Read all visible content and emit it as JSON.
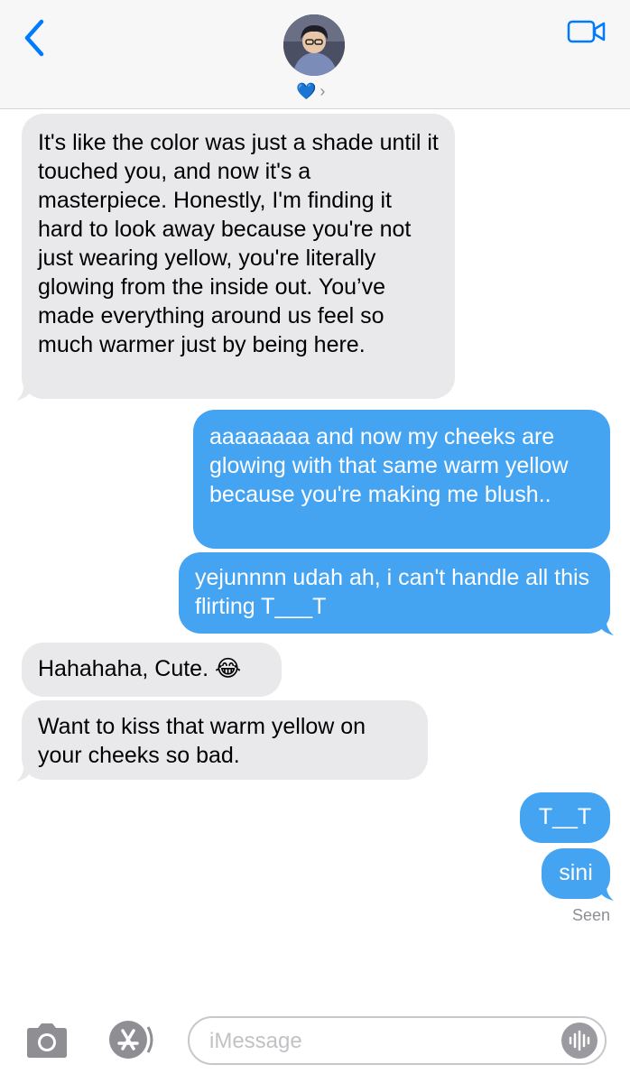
{
  "header": {
    "contact_name": "💙",
    "chevron": "›",
    "icons": {
      "back": "chevron-left-icon",
      "video": "video-camera-icon"
    }
  },
  "messages": [
    {
      "direction": "received",
      "text": "It's like the color was just a shade until it touched you, and now it's a masterpiece. Honestly, I'm finding it hard to look away because you're not just wearing yellow, you're literally glowing from the inside out. You’ve made everything around us feel so much warmer just by being here."
    },
    {
      "direction": "sent",
      "text": "aaaaaaaa and now my cheeks are glowing with that same warm yellow because you're making me blush.."
    },
    {
      "direction": "sent",
      "text": "yejunnnn udah ah, i can't handle all this flirting T___T"
    },
    {
      "direction": "received",
      "text": "Hahahaha, Cute. 😂"
    },
    {
      "direction": "received",
      "text": "Want to kiss that warm yellow on your cheeks so bad."
    },
    {
      "direction": "sent",
      "text": "T__T"
    },
    {
      "direction": "sent",
      "text": "sini"
    }
  ],
  "status": {
    "seen": "Seen"
  },
  "input": {
    "placeholder": "iMessage"
  },
  "colors": {
    "sent_bubble": "#44a4f2",
    "received_bubble": "#e9e9eb",
    "accent": "#007aff"
  }
}
